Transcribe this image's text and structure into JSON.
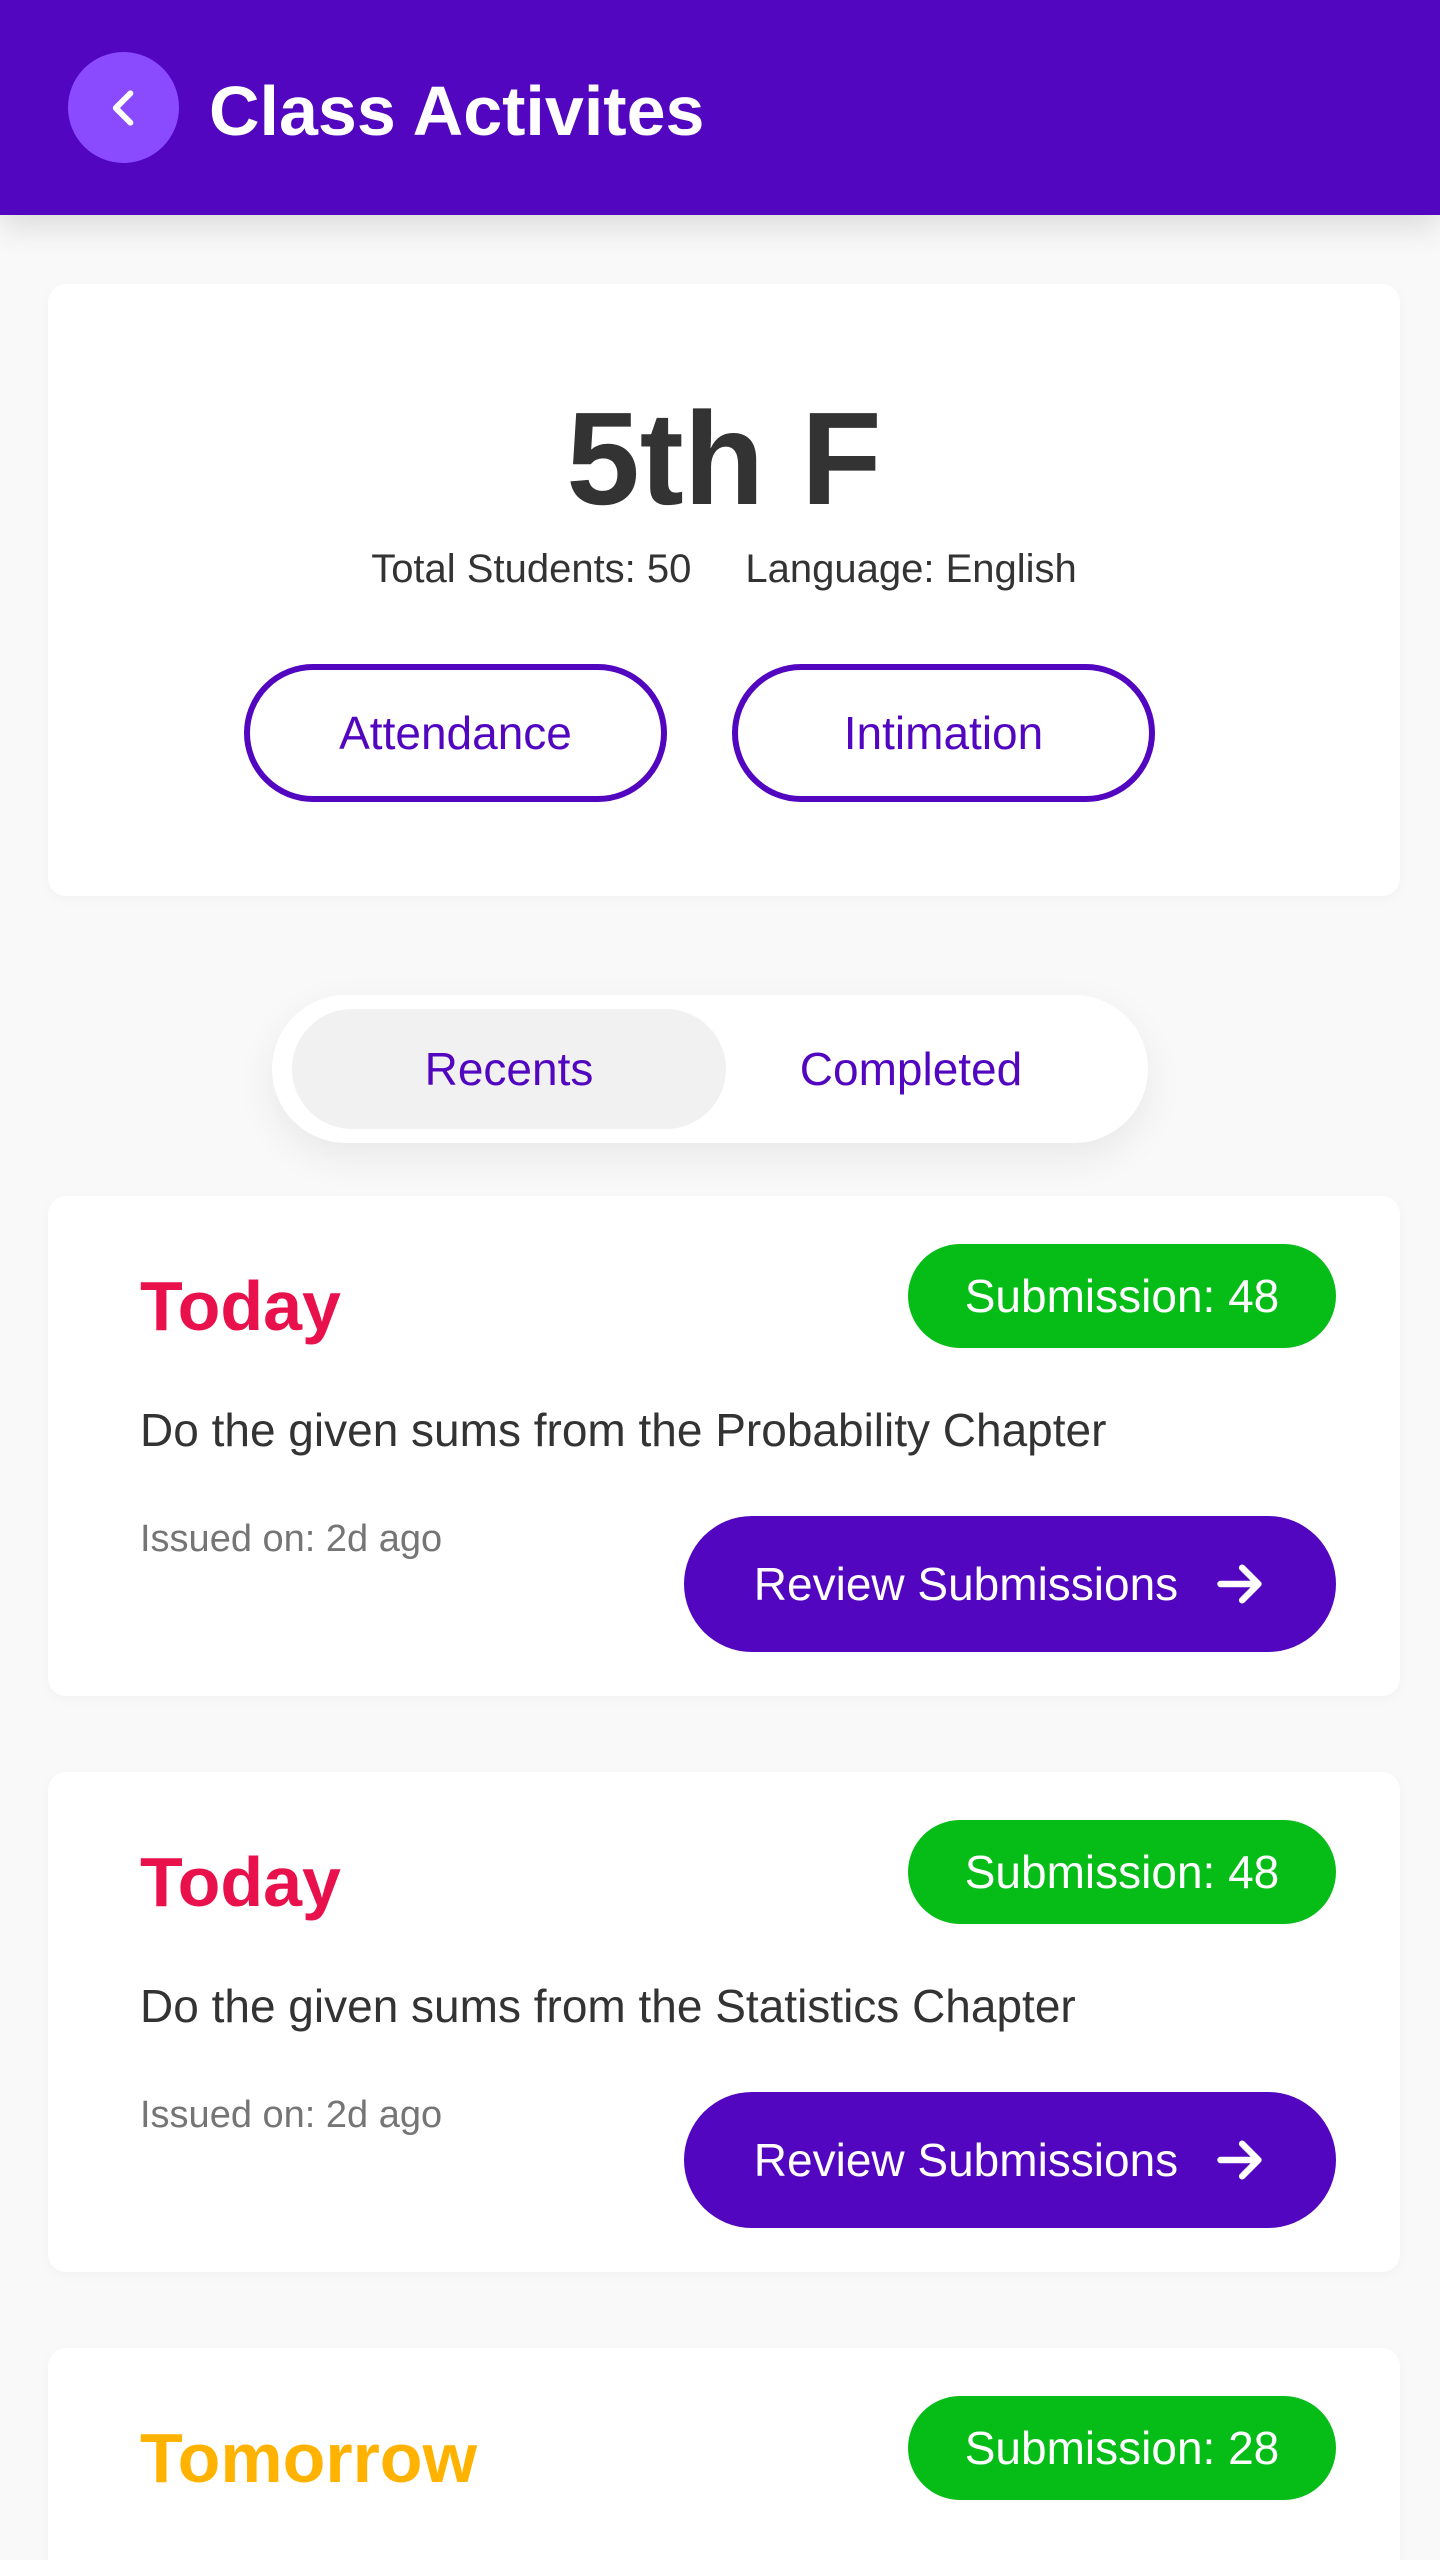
{
  "header": {
    "title": "Class Activites",
    "back_icon": "chevron-left-icon"
  },
  "colors": {
    "primary": "#5206bf",
    "back_button": "#8a4bff",
    "badge_green": "#06bd18",
    "today": "#e8114c",
    "tomorrow": "#ffb300"
  },
  "class_info": {
    "name": "5th F",
    "total_students": "Total Students: 50",
    "language": "Language: English",
    "attendance_label": "Attendance",
    "intimation_label": "Intimation"
  },
  "tabs": {
    "recents": "Recents",
    "completed": "Completed",
    "selected": "Recents"
  },
  "activities": [
    {
      "when": "Today",
      "submission": "Submission: 48",
      "description": "Do the given sums from the Probability Chapter",
      "issued": "Issued on: 2d ago",
      "action_label": "Review Submissions"
    },
    {
      "when": "Today",
      "submission": "Submission: 48",
      "description": "Do the given sums from the Statistics Chapter",
      "issued": "Issued on: 2d ago",
      "action_label": "Review Submissions"
    },
    {
      "when": "Tomorrow",
      "submission": "Submission: 28"
    }
  ]
}
